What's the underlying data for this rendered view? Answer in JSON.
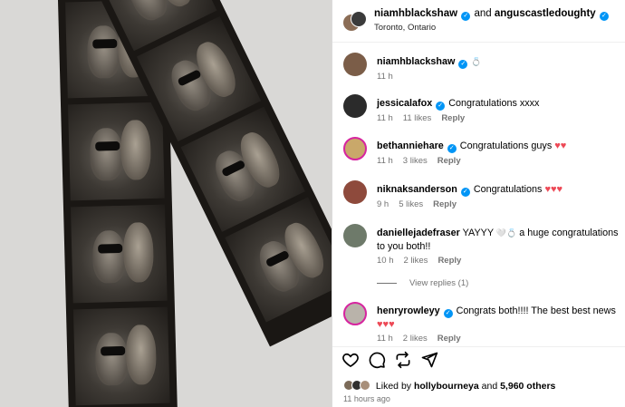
{
  "post": {
    "author_primary": "niamhblackshaw",
    "connector": "and",
    "author_secondary": "anguscastledoughty",
    "location": "Toronto, Ontario"
  },
  "caption": {
    "user": "niamhblackshaw",
    "text": "💍",
    "time": "11 h"
  },
  "comments": [
    {
      "user": "jessicalafox",
      "verified": true,
      "text": "Congratulations xxxx",
      "time": "11 h",
      "likes": "11 likes",
      "reply": "Reply"
    },
    {
      "user": "bethanniehare",
      "verified": true,
      "text": "Congratulations guys",
      "time": "11 h",
      "likes": "3 likes",
      "reply": "Reply"
    },
    {
      "user": "niknaksanderson",
      "verified": true,
      "text": "Congratulations",
      "time": "9 h",
      "likes": "5 likes",
      "reply": "Reply"
    },
    {
      "user": "daniellejadefraser",
      "verified": false,
      "text_a": "YAYYY",
      "text_b": "a huge congratulations to you both!!",
      "time": "10 h",
      "likes": "2 likes",
      "reply": "Reply",
      "view_replies": "View replies (1)"
    },
    {
      "user": "henryrowleyy",
      "verified": true,
      "text": "Congrats both!!!! The best best news",
      "time": "11 h",
      "likes": "2 likes",
      "reply": "Reply"
    }
  ],
  "footer": {
    "liked_by_prefix": "Liked by",
    "liked_by_user": "hollybourneya",
    "and": "and",
    "others": "5,960 others",
    "time": "11 hours ago"
  },
  "icons": [
    "heart-icon",
    "comment-icon",
    "repost-icon",
    "share-icon"
  ],
  "colors": {
    "verified": "#0095f6",
    "heart": "#ed4956",
    "muted": "#737373"
  }
}
